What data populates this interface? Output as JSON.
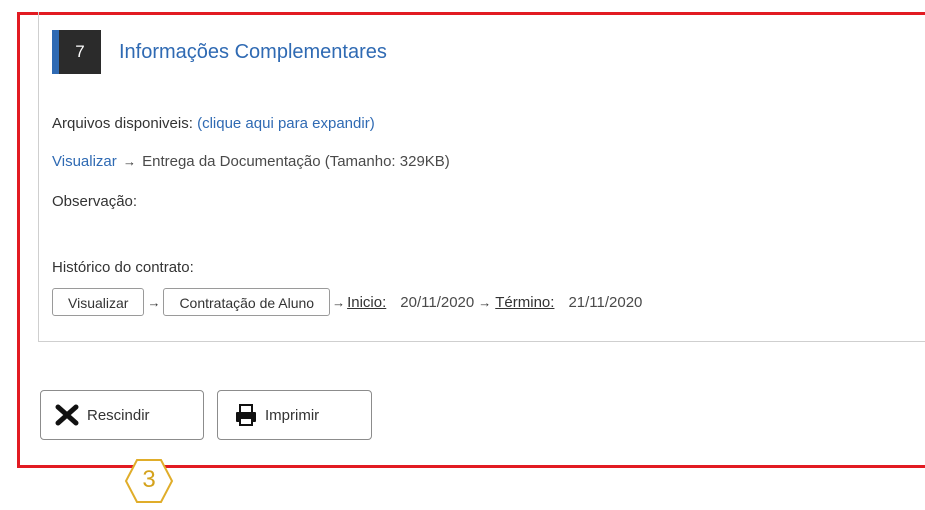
{
  "section": {
    "number": "7",
    "title": "Informações Complementares"
  },
  "files": {
    "label": "Arquivos disponiveis:",
    "expand_link": "(clique aqui para expandir)"
  },
  "document": {
    "view_link": "Visualizar",
    "arrow": "→",
    "name": "Entrega da Documentação (Tamanho: 329KB)"
  },
  "observation": {
    "label": "Observação:"
  },
  "history": {
    "label": "Histórico do contrato:",
    "view_button": "Visualizar",
    "arrow": "→",
    "type_button": "Contratação de Aluno",
    "start_label": "Inicio:",
    "start_date": "20/11/2020",
    "end_label": "Término:",
    "end_date": "21/11/2020"
  },
  "actions": {
    "rescind_label": "Rescindir",
    "print_label": "Imprimir"
  },
  "annotation": {
    "step_number": "3"
  },
  "colors": {
    "accent": "#2f6ab3",
    "frame": "#e21b22",
    "badge": "#e0ad2a"
  }
}
